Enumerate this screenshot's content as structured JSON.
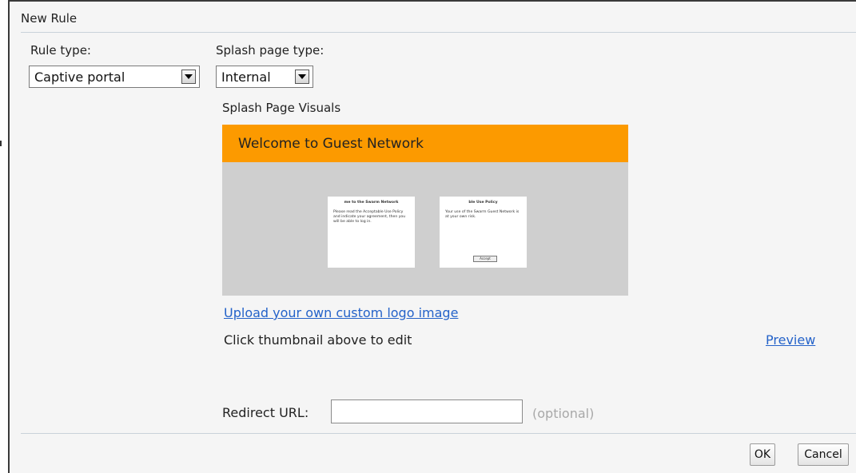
{
  "dialog": {
    "title": "New Rule"
  },
  "rule_type": {
    "label": "Rule type:",
    "selected": "Captive portal"
  },
  "splash_page_type": {
    "label": "Splash page type:",
    "selected": "Internal"
  },
  "splash_visuals": {
    "heading": "Splash Page Visuals",
    "banner_text": "Welcome to Guest Network",
    "card_left": {
      "title": "me to the Swarm Network",
      "body": "Please read the Acceptable Use Policy and indicate your agreement, then you will be able to log in."
    },
    "card_right": {
      "title": "ble Use Policy",
      "body": "Your use of the Swarm Guest Network is at your own risk.",
      "button": "Accept"
    },
    "upload_link": "Upload your own custom logo image",
    "hint": "Click thumbnail above to edit",
    "preview_link": "Preview"
  },
  "redirect": {
    "label": "Redirect URL:",
    "value": "",
    "optional_note": "(optional)"
  },
  "footer": {
    "ok_label": "OK",
    "cancel_label": "Cancel"
  },
  "colors": {
    "banner": "#fc9a00",
    "link": "#2563c9",
    "thumb_bg": "#cfcfcf"
  }
}
